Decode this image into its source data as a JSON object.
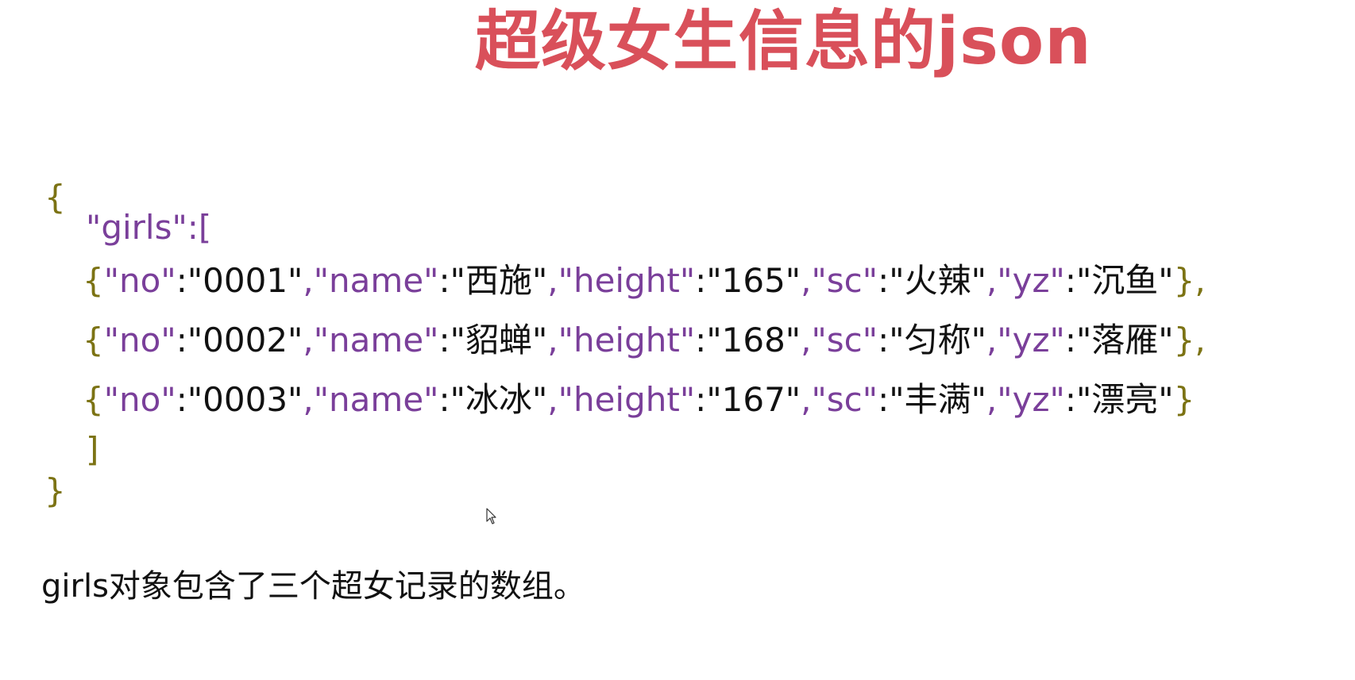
{
  "title": "超级女生信息的json",
  "code": {
    "open_brace": "{",
    "girls_key": "\"girls\":[",
    "records": [
      {
        "open": "{",
        "k_no": "\"no\"",
        "colon1": ":",
        "v_no": "\"0001\"",
        "sep1": ",",
        "k_name": "\"name\"",
        "colon2": ":",
        "v_name": "\"西施\"",
        "sep2": ",",
        "k_height": "\"height\"",
        "colon3": ":",
        "v_height": "\"165\"",
        "sep3": ",",
        "k_sc": "\"sc\"",
        "colon4": ":",
        "v_sc": "\"火辣\"",
        "sep4": ",",
        "k_yz": "\"yz\"",
        "colon5": ":",
        "v_yz": "\"沉鱼\"",
        "close": "},"
      },
      {
        "open": "{",
        "k_no": "\"no\"",
        "colon1": ":",
        "v_no": "\"0002\"",
        "sep1": ",",
        "k_name": "\"name\"",
        "colon2": ":",
        "v_name": "\"貂蝉\"",
        "sep2": ",",
        "k_height": "\"height\"",
        "colon3": ":",
        "v_height": "\"168\"",
        "sep3": ",",
        "k_sc": "\"sc\"",
        "colon4": ":",
        "v_sc": "\"匀称\"",
        "sep4": ",",
        "k_yz": "\"yz\"",
        "colon5": ":",
        "v_yz": "\"落雁\"",
        "close": "},"
      },
      {
        "open": "{",
        "k_no": "\"no\"",
        "colon1": ":",
        "v_no": "\"0003\"",
        "sep1": ",",
        "k_name": "\"name\"",
        "colon2": ":",
        "v_name": "\"冰冰\"",
        "sep2": ",",
        "k_height": "\"height\"",
        "colon3": ":",
        "v_height": "\"167\"",
        "sep3": ",",
        "k_sc": "\"sc\"",
        "colon4": ":",
        "v_sc": "\"丰满\"",
        "sep4": ",",
        "k_yz": "\"yz\"",
        "colon5": ":",
        "v_yz": "\"漂亮\"",
        "close": "}"
      }
    ],
    "close_bracket": "]",
    "close_brace": "}"
  },
  "caption": "girls对象包含了三个超女记录的数组。",
  "colors": {
    "title": "#d9505a",
    "brace": "#7c7314",
    "key": "#7a3f9a",
    "value": "#111111"
  },
  "icons": {
    "cursor": "mouse-pointer-icon"
  }
}
